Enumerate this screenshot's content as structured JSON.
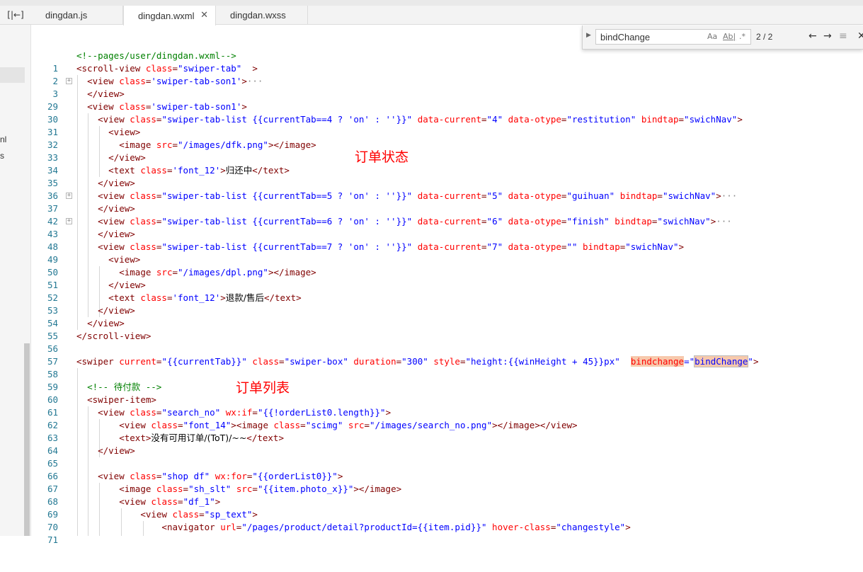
{
  "tabs": [
    {
      "label": "dingdan.js"
    },
    {
      "label": "dingdan.wxml",
      "close": "✕"
    },
    {
      "label": "dingdan.wxss"
    }
  ],
  "sidebar": {
    "fragments": [
      "nl",
      "s"
    ]
  },
  "find": {
    "query": "bindChange",
    "match_case": "Aa",
    "whole_word": "Ab|",
    "regex": ".*",
    "count": "2 / 2"
  },
  "annotations": {
    "order_status": "订单状态",
    "order_list": "订单列表"
  },
  "code": {
    "l1": {
      "n": "1",
      "t": "<!--pages/user/dingdan.wxml-->"
    },
    "l2": {
      "n": "2",
      "tag": "<scroll-view",
      "a1": "class",
      "v1": "\"swiper-tab\"",
      "rest": "  >"
    },
    "l3": {
      "n": "3",
      "tag": "<view",
      "a1": "class",
      "v1": "'swiper-tab-son1'",
      "rest": ">",
      "ell": "···"
    },
    "l29": {
      "n": "29",
      "tag": "</view>"
    },
    "l30": {
      "n": "30",
      "tag": "<view",
      "a1": "class",
      "v1": "'swiper-tab-son1'",
      "rest": ">"
    },
    "l31": {
      "n": "31",
      "tag": "<view",
      "a1": "class",
      "v1": "\"swiper-tab-list {{currentTab==4 ? 'on' : ''}}\"",
      "a2": "data-current",
      "v2": "\"4\"",
      "a3": "data-otype",
      "v3": "\"restitution\"",
      "a4": "bindtap",
      "v4": "\"swichNav\"",
      "rest": ">"
    },
    "l32": {
      "n": "32",
      "tag": "<view>"
    },
    "l33": {
      "n": "33",
      "tag": "<image",
      "a1": "src",
      "v1": "\"/images/dfk.png\"",
      "rest": "></image>"
    },
    "l34": {
      "n": "34",
      "tag": "</view>"
    },
    "l35": {
      "n": "35",
      "tag": "<text",
      "a1": "class",
      "v1": "'font_12'",
      "rest": ">",
      "text": "归还中",
      "close": "</text>"
    },
    "l36": {
      "n": "36",
      "tag": "</view>"
    },
    "l37": {
      "n": "37",
      "tag": "<view",
      "a1": "class",
      "v1": "\"swiper-tab-list {{currentTab==5 ? 'on' : ''}}\"",
      "a2": "data-current",
      "v2": "\"5\"",
      "a3": "data-otype",
      "v3": "\"guihuan\"",
      "a4": "bindtap",
      "v4": "\"swichNav\"",
      "rest": ">",
      "ell": "···"
    },
    "l42": {
      "n": "42",
      "tag": "</view>"
    },
    "l43": {
      "n": "43",
      "tag": "<view",
      "a1": "class",
      "v1": "\"swiper-tab-list {{currentTab==6 ? 'on' : ''}}\"",
      "a2": "data-current",
      "v2": "\"6\"",
      "a3": "data-otype",
      "v3": "\"finish\"",
      "a4": "bindtap",
      "v4": "\"swichNav\"",
      "rest": ">",
      "ell": "···"
    },
    "l48": {
      "n": "48",
      "tag": "</view>"
    },
    "l49": {
      "n": "49",
      "tag": "<view",
      "a1": "class",
      "v1": "\"swiper-tab-list {{currentTab==7 ? 'on' : ''}}\"",
      "a2": "data-current",
      "v2": "\"7\"",
      "a3": "data-otype",
      "v3": "\"\"",
      "a4": "bindtap",
      "v4": "\"swichNav\"",
      "rest": ">"
    },
    "l50": {
      "n": "50",
      "tag": "<view>"
    },
    "l51": {
      "n": "51",
      "tag": "<image",
      "a1": "src",
      "v1": "\"/images/dpl.png\"",
      "rest": "></image>"
    },
    "l52": {
      "n": "52",
      "tag": "</view>"
    },
    "l53": {
      "n": "53",
      "tag": "<text",
      "a1": "class",
      "v1": "'font_12'",
      "rest": ">",
      "text": "退款/售后",
      "close": "</text>"
    },
    "l54": {
      "n": "54",
      "tag": "</view>"
    },
    "l55": {
      "n": "55",
      "tag": "</view>"
    },
    "l56": {
      "n": "56",
      "tag": "</scroll-view>"
    },
    "l57": {
      "n": "57"
    },
    "l58": {
      "n": "58",
      "tag": "<swiper",
      "a1": "current",
      "v1": "\"{{currentTab}}\"",
      "a2": "class",
      "v2": "\"swiper-box\"",
      "a3": "duration",
      "v3": "\"300\"",
      "a4": "style",
      "v4": "\"height:{{winHeight + 45}}px\"",
      "a5": "bindchange",
      "eq5": "=\"",
      "v5": "bindChange",
      "q5": "\"",
      "rest": ">"
    },
    "l59": {
      "n": "59"
    },
    "l60": {
      "n": "60",
      "t": "<!-- 待付款 -->"
    },
    "l61": {
      "n": "61",
      "tag": "<swiper-item>"
    },
    "l62": {
      "n": "62",
      "tag": "<view",
      "a1": "class",
      "v1": "\"search_no\"",
      "a2": "wx:if",
      "v2": "\"{{!orderList0.length}}\"",
      "rest": ">"
    },
    "l63": {
      "n": "63",
      "tag": "<view",
      "a1": "class",
      "v1": "\"font_14\"",
      "rest": "><image",
      "a2": "class",
      "v2": "\"scimg\"",
      "a3": "src",
      "v3": "\"/images/search_no.png\"",
      "rest2": "></image></view>"
    },
    "l64": {
      "n": "64",
      "tag": "<text>",
      "text": "没有可用订单/(ToT)/~~",
      "close": "</text>"
    },
    "l65": {
      "n": "65",
      "tag": "</view>"
    },
    "l66": {
      "n": "66"
    },
    "l67": {
      "n": "67",
      "tag": "<view",
      "a1": "class",
      "v1": "\"shop df\"",
      "a2": "wx:for",
      "v2": "\"{{orderList0}}\"",
      "rest": ">"
    },
    "l68": {
      "n": "68",
      "tag": "<image",
      "a1": "class",
      "v1": "\"sh_slt\"",
      "a2": "src",
      "v2": "\"{{item.photo_x}}\"",
      "rest": "></image>"
    },
    "l69": {
      "n": "69",
      "tag": "<view",
      "a1": "class",
      "v1": "\"df_1\"",
      "rest": ">"
    },
    "l70": {
      "n": "70",
      "tag": "<view",
      "a1": "class",
      "v1": "\"sp_text\"",
      "rest": ">"
    },
    "l71": {
      "n": "71",
      "tag": "<navigator",
      "a1": "url",
      "v1": "\"/pages/product/detail?productId={{item.pid}}\"",
      "a2": "hover-class",
      "v2": "\"changestyle\"",
      "rest": ">"
    }
  }
}
